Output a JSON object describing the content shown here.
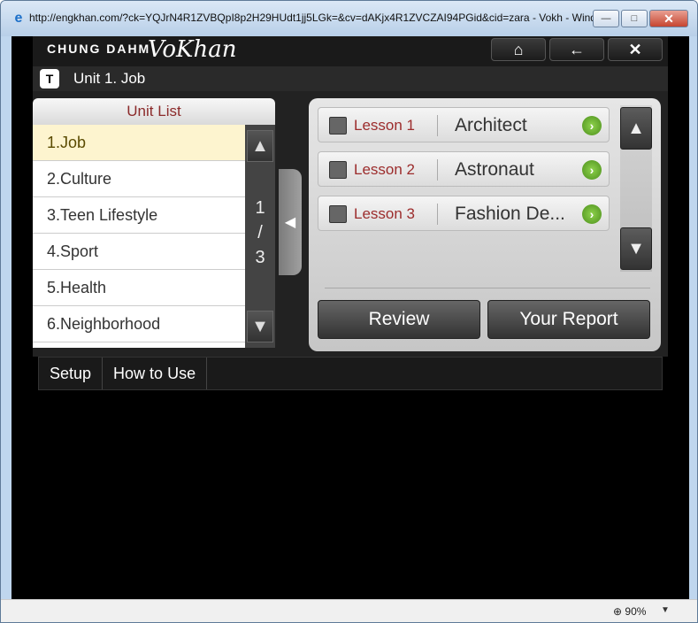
{
  "browser": {
    "title": "http://engkhan.com/?ck=YQJrN4R1ZVBQpI8p2H29HUdt1jj5LGk=&cv=dAKjx4R1ZVCZAI94PGid&cid=zara - Vokh - Wind...",
    "zoom": "90%"
  },
  "app": {
    "brand": "CHUNG DAHM",
    "brand_script": "VoKhan",
    "unit_badge": "T",
    "unit_title": "Unit 1. Job"
  },
  "unit_list": {
    "header": "Unit List",
    "items": [
      "1.Job",
      "2.Culture",
      "3.Teen Lifestyle",
      "4.Sport",
      "5.Health",
      "6.Neighborhood"
    ],
    "page_current": "1",
    "page_sep": "/",
    "page_total": "3"
  },
  "lessons": [
    {
      "number": "Lesson 1",
      "name": "Architect"
    },
    {
      "number": "Lesson 2",
      "name": "Astronaut"
    },
    {
      "number": "Lesson 3",
      "name": "Fashion De..."
    }
  ],
  "actions": {
    "review": "Review",
    "report": "Your Report"
  },
  "bottom": {
    "setup": "Setup",
    "how_to_use": "How to Use"
  }
}
